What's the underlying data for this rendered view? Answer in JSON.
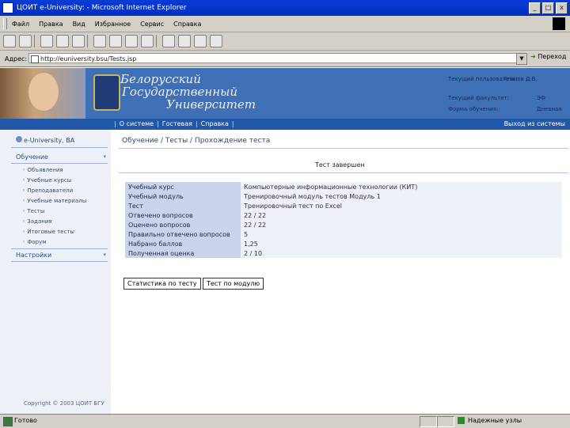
{
  "window": {
    "title": "ЦОИТ e-University: - Microsoft Internet Explorer",
    "buttons": [
      "_",
      "□",
      "x"
    ]
  },
  "menu": [
    "Файл",
    "Правка",
    "Вид",
    "Избранное",
    "Сервис",
    "Справка"
  ],
  "address": {
    "label": "Адрес:",
    "url": "http://euniversity.bsu/Tests.jsp",
    "go_label": "Переход"
  },
  "banner": {
    "university_lines": [
      "Белорусский",
      "Государственный",
      "Университет"
    ],
    "user_info": [
      {
        "label": "Текущий пользователь:",
        "value": "Агапов Д.В."
      },
      {
        "label": "Текущий факультет:",
        "value": "ЭФ"
      },
      {
        "label": "Форма обучения:",
        "value": "Дневная"
      }
    ]
  },
  "nav": {
    "links": [
      "О системе",
      "Гостевая",
      "Справка"
    ],
    "logout": "Выход из системы"
  },
  "sidebar": {
    "header": "e-University, BA",
    "sections": [
      {
        "label": "Обучение",
        "items": [
          "Объявления",
          "Учебные курсы",
          "Преподаватели",
          "Учебные материалы",
          "Тесты",
          "Задания",
          "Итоговые тесты",
          "Форум"
        ]
      },
      {
        "label": "Настройки"
      }
    ],
    "copyright": "Copyright © 2003 ЦОИТ БГУ"
  },
  "main": {
    "breadcrumb": "Обучение / Тесты / Прохождение теста",
    "status": "Тест завершен",
    "rows": [
      {
        "key": "Учебный курс",
        "value": "Компьютерные информационные технологии (КИТ)"
      },
      {
        "key": "Учебный модуль",
        "value": "Тренировочный модуль тестов Модуль 1"
      },
      {
        "key": "Тест",
        "value": "Тренировочный тест по Excel"
      },
      {
        "key": "Отвечено вопросов",
        "value": "22 / 22"
      },
      {
        "key": "Оценено вопросов",
        "value": "22 / 22"
      },
      {
        "key": "Правильно отвечено вопросов",
        "value": "5"
      },
      {
        "key": "Набрано баллов",
        "value": "1,25"
      },
      {
        "key": "Полученная оценка",
        "value": "2 / 10"
      }
    ],
    "buttons": [
      "Статистика по тесту",
      "Тест по модулю"
    ]
  },
  "status_bar": {
    "text": "Готово",
    "zone": "Надежные узлы"
  }
}
